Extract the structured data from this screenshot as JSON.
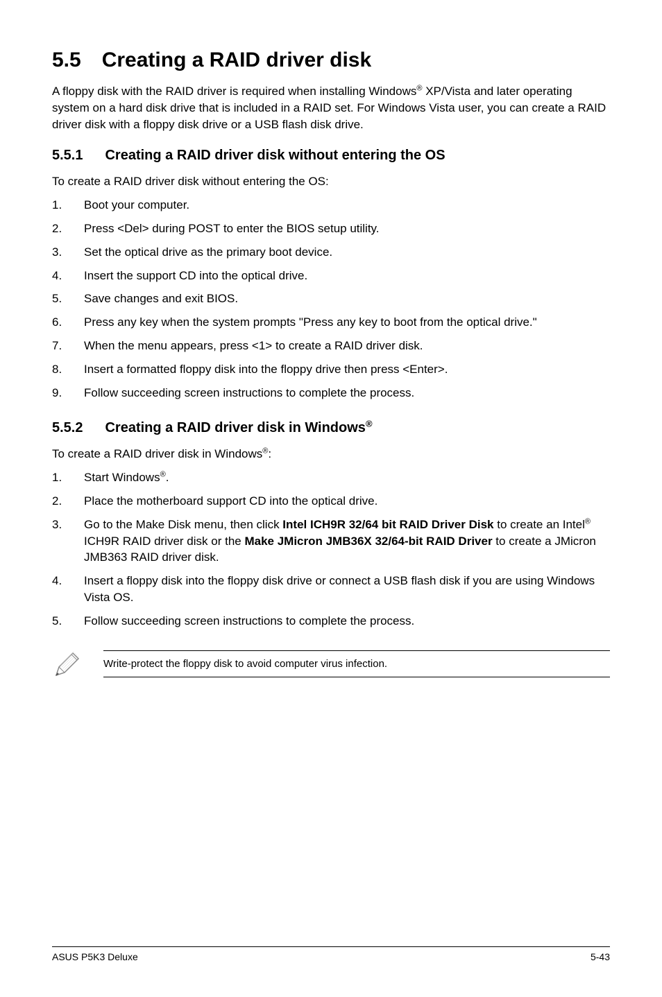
{
  "section": {
    "number": "5.5",
    "title": "Creating a RAID driver disk"
  },
  "intro": {
    "seg1": "A floppy disk with the RAID driver is required when installing Windows",
    "sup1": "®",
    "seg2": " XP/Vista and later operating system on a hard disk drive that is included in a RAID set. For Windows Vista user, you can create a RAID driver disk with a floppy disk drive or a USB flash disk drive."
  },
  "sub1": {
    "number": "5.5.1",
    "title": "Creating a RAID driver disk without entering the OS",
    "para": "To create a RAID driver disk without entering the OS:",
    "steps": [
      "Boot your computer.",
      "Press <Del> during POST to enter the BIOS setup utility.",
      "Set the optical drive as the primary boot device.",
      "Insert the support CD into the optical drive.",
      "Save changes and exit BIOS.",
      "Press any key when the system prompts \"Press any key to boot from the optical drive.\"",
      "When the menu appears, press <1> to create a RAID driver disk.",
      "Insert a formatted floppy disk into the floppy drive then press <Enter>.",
      "Follow succeeding screen instructions to complete the process."
    ]
  },
  "sub2": {
    "number": "5.5.2",
    "title_seg1": "Creating a RAID driver disk in Windows",
    "title_sup": "®",
    "para_seg1": "To create a RAID driver disk in Windows",
    "para_sup": "®",
    "para_seg2": ":",
    "step1_seg1": "Start Windows",
    "step1_sup": "®",
    "step1_seg2": ".",
    "step2": "Place the motherboard support CD into the optical drive.",
    "step3_seg1": "Go to the Make Disk menu, then click ",
    "step3_bold1": "Intel ICH9R 32/64 bit RAID Driver Disk",
    "step3_seg2": " to create an Intel",
    "step3_sup": "®",
    "step3_seg3": " ICH9R RAID driver disk or the ",
    "step3_bold2": "Make JMicron JMB36X 32/64-bit RAID Driver",
    "step3_seg4": " to create a JMicron JMB363 RAID driver disk.",
    "step4": "Insert a floppy disk into the floppy disk drive or connect a USB flash disk if you are using Windows Vista OS.",
    "step5": "Follow succeeding screen instructions to complete the process."
  },
  "note": "Write-protect the floppy disk to avoid computer virus infection.",
  "footer": {
    "left": "ASUS P5K3 Deluxe",
    "right": "5-43"
  }
}
